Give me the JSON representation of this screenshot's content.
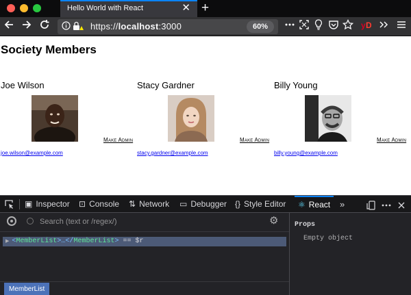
{
  "browser": {
    "tab_title": "Hello World with React",
    "tab_close": "✕",
    "new_tab": "+",
    "url_scheme": "https://",
    "url_host": "localhost",
    "url_port": ":3000",
    "zoom": "60%",
    "accent_color": "#0a84ff"
  },
  "page": {
    "title": "Society Members",
    "members": [
      {
        "name": "Joe Wilson",
        "email": "joe.wilson@example.com",
        "action": "Make Admin"
      },
      {
        "name": "Stacy Gardner",
        "email": "stacy.gardner@example.com",
        "action": "Make Admin"
      },
      {
        "name": "Billy Young",
        "email": "billy.young@example.com",
        "action": "Make Admin"
      }
    ]
  },
  "devtools": {
    "tabs": [
      {
        "label": "Inspector",
        "icon": "inspector-icon"
      },
      {
        "label": "Console",
        "icon": "console-icon"
      },
      {
        "label": "Network",
        "icon": "network-icon"
      },
      {
        "label": "Debugger",
        "icon": "debugger-icon"
      },
      {
        "label": "Style Editor",
        "icon": "style-editor-icon"
      },
      {
        "label": "React",
        "icon": "react-icon"
      }
    ],
    "active_tab": "React",
    "search_placeholder": "Search (text or /regex/)",
    "tree": {
      "open_tag": "<",
      "component": "MemberList",
      "middle": ">…</",
      "close_tag": ">",
      "suffix": " == $r"
    },
    "breadcrumb": "MemberList",
    "props": {
      "title": "Props",
      "empty": "Empty object"
    }
  }
}
